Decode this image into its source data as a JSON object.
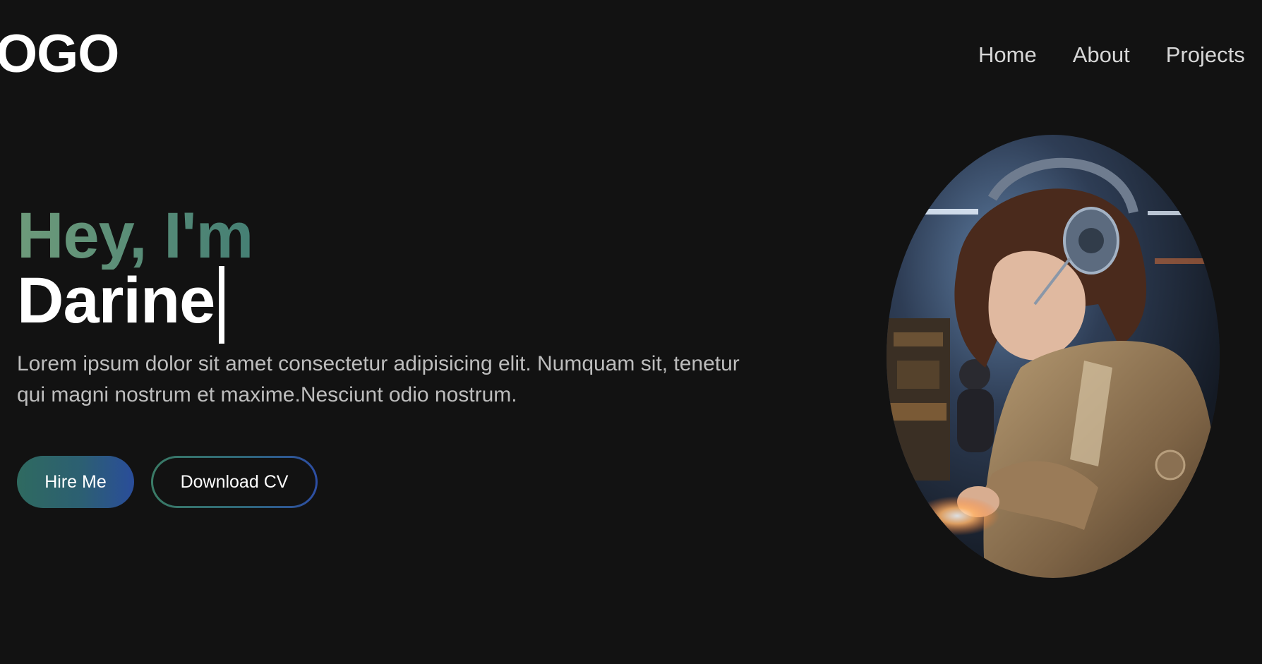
{
  "header": {
    "logo_text": "OGO",
    "nav": [
      {
        "label": "Home"
      },
      {
        "label": "About"
      },
      {
        "label": "Projects"
      }
    ]
  },
  "hero": {
    "greeting": "Hey, I'm",
    "name": "Darine",
    "description": "Lorem ipsum dolor sit amet consectetur adipisicing elit. Numquam sit, tenetur qui magni nostrum et maxime.Nesciunt odio nostrum.",
    "buttons": {
      "hire": "Hire Me",
      "download": "Download CV"
    }
  },
  "colors": {
    "background": "#121212",
    "text": "#ffffff",
    "muted_text": "#bdbdbd",
    "gradient_start": "#3a7b66",
    "gradient_end": "#2d4ea4"
  },
  "images": {
    "portrait": "illustrated-woman-with-headphones-portrait"
  }
}
